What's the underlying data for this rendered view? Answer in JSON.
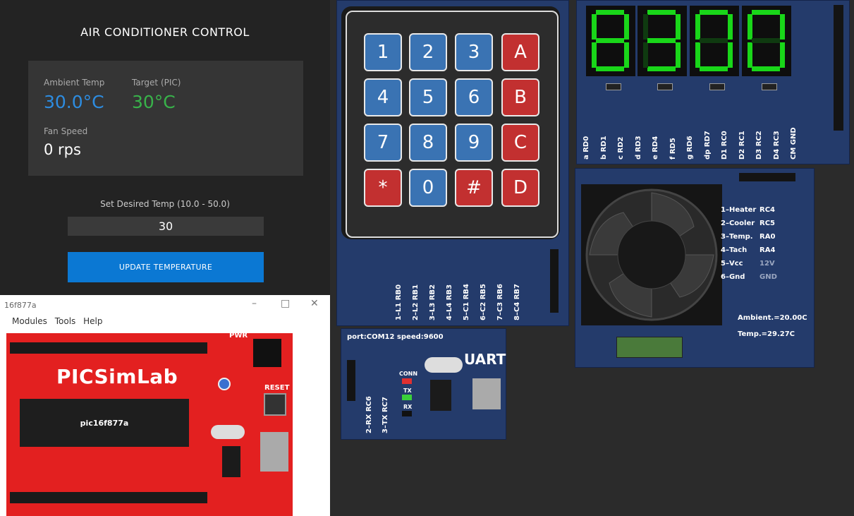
{
  "ac_panel": {
    "title": "AIR CONDITIONER CONTROL",
    "ambient_label": "Ambient Temp",
    "ambient_value": "30.0°C",
    "target_label": "Target (PIC)",
    "target_value": "30°C",
    "fan_label": "Fan Speed",
    "fan_value": "0 rps",
    "set_label": "Set Desired Temp (10.0 - 50.0)",
    "input_value": "30",
    "button_label": "UPDATE TEMPERATURE",
    "colors": {
      "ambient": "#2d8ce0",
      "target": "#38b24a",
      "button": "#0b78d3"
    }
  },
  "picsim_window": {
    "title": "16f877a",
    "menu": [
      "Modules",
      "Tools",
      "Help"
    ],
    "board_brand": "PICSimLab",
    "chip_label": "pic16f877a",
    "reset_label": "RESET",
    "pwr_label": "PWR",
    "window_controls": [
      "–",
      "□",
      "✕"
    ]
  },
  "keypad": {
    "keys": [
      {
        "label": "1",
        "color": "blue"
      },
      {
        "label": "2",
        "color": "blue"
      },
      {
        "label": "3",
        "color": "blue"
      },
      {
        "label": "A",
        "color": "red"
      },
      {
        "label": "4",
        "color": "blue"
      },
      {
        "label": "5",
        "color": "blue"
      },
      {
        "label": "6",
        "color": "blue"
      },
      {
        "label": "B",
        "color": "red"
      },
      {
        "label": "7",
        "color": "blue"
      },
      {
        "label": "8",
        "color": "blue"
      },
      {
        "label": "9",
        "color": "blue"
      },
      {
        "label": "C",
        "color": "red"
      },
      {
        "label": "*",
        "color": "red"
      },
      {
        "label": "0",
        "color": "blue"
      },
      {
        "label": "#",
        "color": "red"
      },
      {
        "label": "D",
        "color": "red"
      }
    ],
    "pins": [
      "1–L1 RB0",
      "2–L2 RB1",
      "3–L3 RB2",
      "4–L4 RB3",
      "5–C1 RB4",
      "6–C2 RB5",
      "7–C3 RB6",
      "8–C4 RB7"
    ]
  },
  "seven_seg": {
    "digits": [
      "8",
      "3",
      "0",
      "0"
    ],
    "pins": [
      "a RD0",
      "b RD1",
      "c RD2",
      "d RD3",
      "e RD4",
      "f RD5",
      "g RD6",
      "dp RD7",
      "D1 RC0",
      "D2 RC1",
      "D3 RC2",
      "D4 RC3",
      "CM GND"
    ]
  },
  "fan_board": {
    "pins": [
      {
        "name": "1–Heater",
        "port": "RC4"
      },
      {
        "name": "2–Cooler",
        "port": "RC5"
      },
      {
        "name": "3–Temp.",
        "port": "RA0"
      },
      {
        "name": "4–Tach",
        "port": "RA4"
      },
      {
        "name": "5–Vcc",
        "port": "12V"
      },
      {
        "name": "6–Gnd",
        "port": "GND"
      }
    ],
    "ambient_readout": "Ambient.=20.00C",
    "temp_readout": "Temp.=29.27C"
  },
  "uart_board": {
    "header": "port:COM12  speed:9600",
    "title": "UART",
    "leds": [
      "CONN",
      "TX",
      "RX"
    ],
    "pins": [
      "2–RX RC6",
      "3–TX RC7"
    ]
  }
}
